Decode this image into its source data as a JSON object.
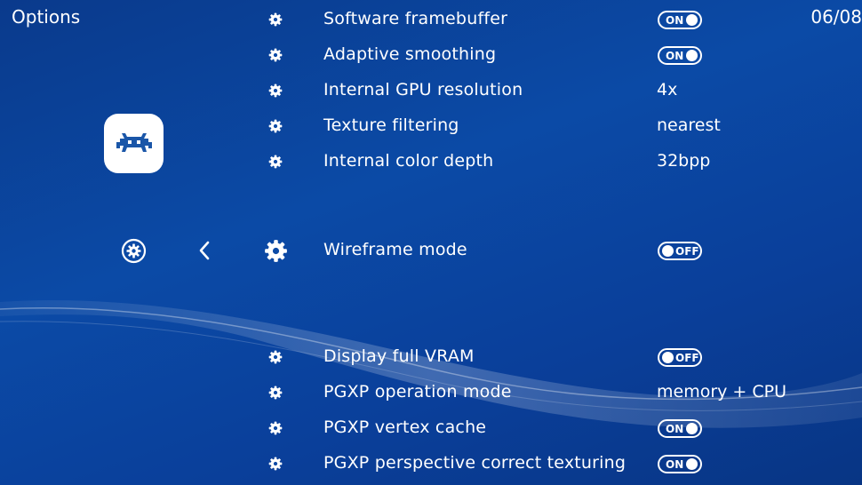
{
  "header": {
    "title": "Options",
    "counter": "06/08"
  },
  "sidebar": {
    "logo_icon": "retroarch-invader-logo",
    "settings_icon": "gear-circle-icon",
    "back_icon": "chevron-left-icon"
  },
  "colors": {
    "background": "#0b4aa6",
    "text": "#ffffff",
    "logo_accent": "#1a56a8"
  },
  "options": [
    {
      "label": "Software framebuffer",
      "type": "toggle",
      "value": "ON"
    },
    {
      "label": "Adaptive smoothing",
      "type": "toggle",
      "value": "ON"
    },
    {
      "label": "Internal GPU resolution",
      "type": "text",
      "value": "4x"
    },
    {
      "label": "Texture filtering",
      "type": "text",
      "value": "nearest"
    },
    {
      "label": "Internal color depth",
      "type": "text",
      "value": "32bpp"
    },
    {
      "label": "Wireframe mode",
      "type": "toggle",
      "value": "OFF",
      "selected": true
    },
    {
      "label": "Display full VRAM",
      "type": "toggle",
      "value": "OFF"
    },
    {
      "label": "PGXP operation mode",
      "type": "text",
      "value": "memory + CPU"
    },
    {
      "label": "PGXP vertex cache",
      "type": "toggle",
      "value": "ON"
    },
    {
      "label": "PGXP perspective correct texturing",
      "type": "toggle",
      "value": "ON"
    }
  ]
}
